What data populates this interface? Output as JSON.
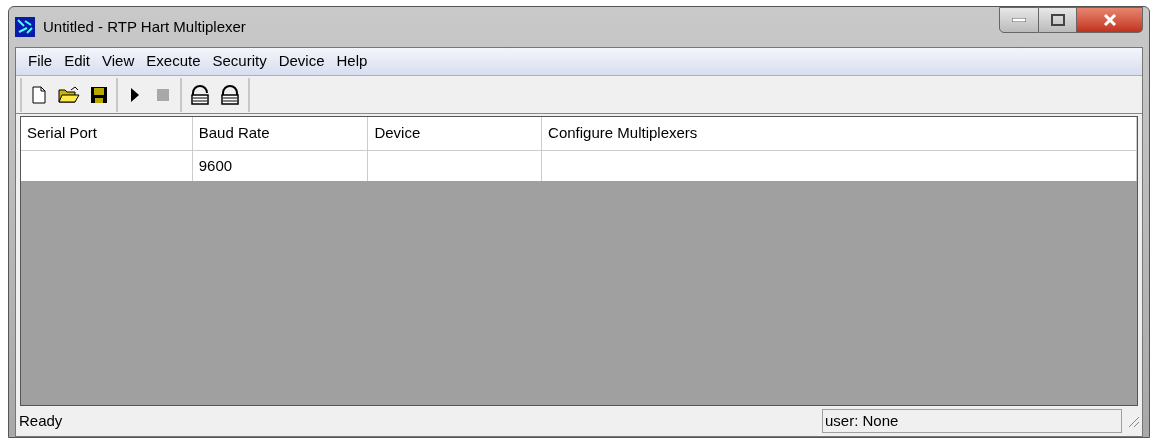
{
  "window": {
    "title": "Untitled - RTP Hart Multiplexer"
  },
  "menu": [
    "File",
    "Edit",
    "View",
    "Execute",
    "Security",
    "Device",
    "Help"
  ],
  "toolbar_groups": [
    {
      "buttons": [
        {
          "kind": "new",
          "disabled": false
        },
        {
          "kind": "open",
          "disabled": false
        },
        {
          "kind": "save",
          "disabled": false
        }
      ]
    },
    {
      "buttons": [
        {
          "kind": "play",
          "disabled": false
        },
        {
          "kind": "stop",
          "disabled": true
        }
      ]
    },
    {
      "buttons": [
        {
          "kind": "unlock",
          "disabled": false
        },
        {
          "kind": "lock",
          "disabled": false
        }
      ]
    }
  ],
  "table": {
    "columns": [
      "Serial Port",
      "Baud Rate",
      "Device",
      "Configure Multiplexers"
    ],
    "rows": [
      [
        "",
        "9600",
        "",
        ""
      ]
    ]
  },
  "status_bar": {
    "message": "Ready",
    "user": "user: None"
  }
}
